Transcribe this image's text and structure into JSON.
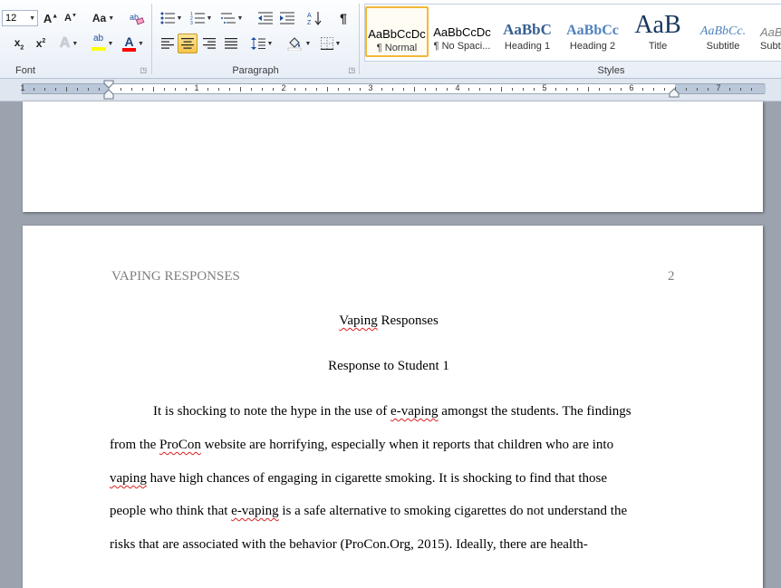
{
  "font_group": {
    "font_size": "12",
    "label": "Font"
  },
  "paragraph_group": {
    "label": "Paragraph"
  },
  "styles_group": {
    "label": "Styles",
    "items": [
      {
        "sample": "AaBbCcDc",
        "name": "¶ Normal"
      },
      {
        "sample": "AaBbCcDc",
        "name": "¶ No Spaci..."
      },
      {
        "sample": "AaBbC",
        "name": "Heading 1"
      },
      {
        "sample": "AaBbCc",
        "name": "Heading 2"
      },
      {
        "sample": "AaB",
        "name": "Title"
      },
      {
        "sample": "AaBbCc.",
        "name": "Subtitle"
      },
      {
        "sample": "AaBbCcDc",
        "name": "Subtl"
      }
    ]
  },
  "ruler": {
    "numbers": [
      "1",
      "1",
      "2",
      "3",
      "4",
      "5",
      "6",
      "7"
    ]
  },
  "colors": {
    "highlight": "#ffff00",
    "font_color": "#ff0000",
    "accent": "#f6c34a",
    "spell_error": "#e02020"
  },
  "document": {
    "header_left": "VAPING RESPONSES",
    "header_right": "2",
    "title_word1": "Vaping",
    "title_word2": " Responses",
    "subtitle": "Response to Student 1",
    "l1_a": "It is shocking to note the hype in the use of ",
    "l1_b": "e-vaping",
    "l1_c": " amongst the students. The findings",
    "l2_a": "from the ",
    "l2_b": "ProCon",
    "l2_c": " website are horrifying, especially when it reports that children who are into",
    "l3_a": "vaping",
    "l3_b": " have high chances of engaging in cigarette smoking. It is shocking to find that those",
    "l4_a": "people who think that ",
    "l4_b": "e-vaping",
    "l4_c": " is a safe alternative to smoking cigarettes do not understand the",
    "l5": "risks that are associated with the behavior (ProCon.Org, 2015). Ideally, there are health-"
  }
}
